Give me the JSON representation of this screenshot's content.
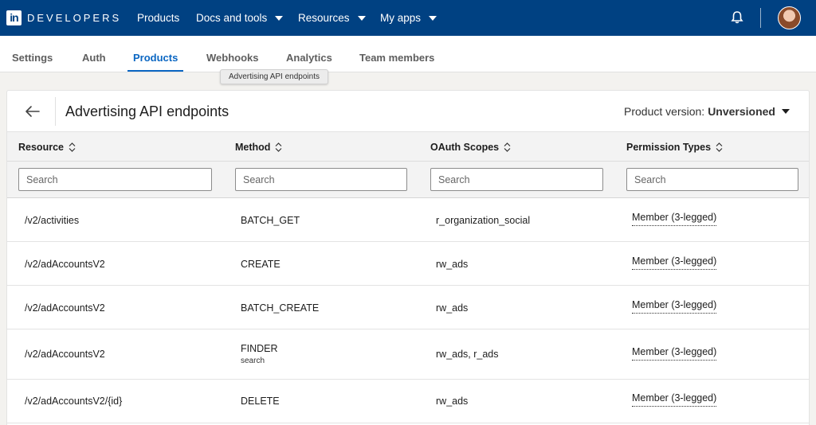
{
  "brand": {
    "logo_text": "in",
    "name": "DEVELOPERS"
  },
  "topnav": {
    "items": [
      {
        "label": "Products",
        "has_caret": false
      },
      {
        "label": "Docs and tools",
        "has_caret": true
      },
      {
        "label": "Resources",
        "has_caret": true
      },
      {
        "label": "My apps",
        "has_caret": true
      }
    ]
  },
  "subtabs": {
    "items": [
      {
        "label": "Settings",
        "active": false
      },
      {
        "label": "Auth",
        "active": false
      },
      {
        "label": "Products",
        "active": true
      },
      {
        "label": "Webhooks",
        "active": false
      },
      {
        "label": "Analytics",
        "active": false
      },
      {
        "label": "Team members",
        "active": false
      }
    ]
  },
  "tooltip": {
    "text": "Advertising API endpoints"
  },
  "card": {
    "title": "Advertising API endpoints",
    "version_label": "Product version:",
    "version_value": "Unversioned"
  },
  "table": {
    "columns": [
      {
        "label": "Resource",
        "placeholder": "Search"
      },
      {
        "label": "Method",
        "placeholder": "Search"
      },
      {
        "label": "OAuth Scopes",
        "placeholder": "Search"
      },
      {
        "label": "Permission Types",
        "placeholder": "Search"
      }
    ],
    "rows": [
      {
        "resource": "/v2/activities",
        "method": "BATCH_GET",
        "method_sub": "",
        "scopes": "r_organization_social",
        "permission": "Member (3-legged)"
      },
      {
        "resource": "/v2/adAccountsV2",
        "method": "CREATE",
        "method_sub": "",
        "scopes": "rw_ads",
        "permission": "Member (3-legged)"
      },
      {
        "resource": "/v2/adAccountsV2",
        "method": "BATCH_CREATE",
        "method_sub": "",
        "scopes": "rw_ads",
        "permission": "Member (3-legged)"
      },
      {
        "resource": "/v2/adAccountsV2",
        "method": "FINDER",
        "method_sub": "search",
        "scopes": "rw_ads, r_ads",
        "permission": "Member (3-legged)"
      },
      {
        "resource": "/v2/adAccountsV2/{id}",
        "method": "DELETE",
        "method_sub": "",
        "scopes": "rw_ads",
        "permission": "Member (3-legged)"
      }
    ]
  },
  "colors": {
    "nav_bg": "#004182",
    "accent": "#0a66c2"
  }
}
